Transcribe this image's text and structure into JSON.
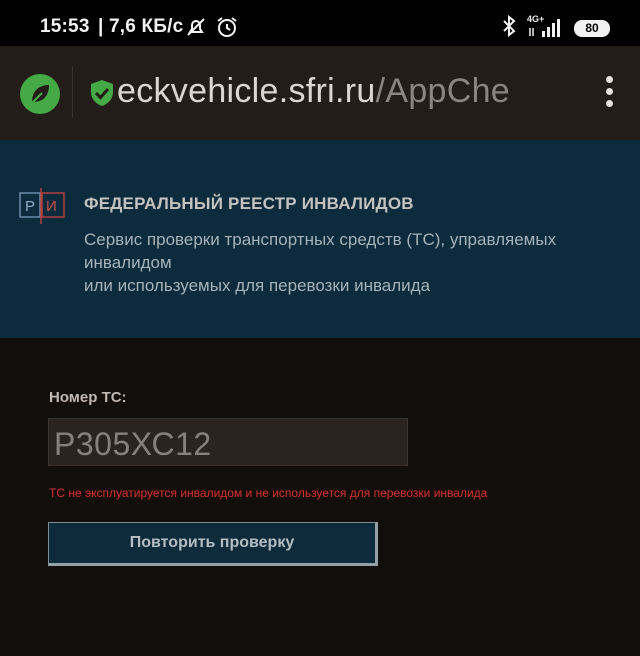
{
  "status_bar": {
    "time": "15:53",
    "speed": "| 7,6 КБ/с",
    "network": "4G+",
    "battery": "80",
    "icons": [
      "alarm-off-icon",
      "alarm-clock-icon",
      "bluetooth-icon",
      "signal-icon",
      "battery-icon"
    ]
  },
  "browser": {
    "url_host": "eckvehicle.sfri.ru",
    "url_path": "/AppChe",
    "icons": [
      "leaf-icon",
      "shield-check-icon",
      "more-vert-icon"
    ],
    "accent": "#45a946"
  },
  "banner": {
    "logo_letters": [
      "Р",
      "И"
    ],
    "title": "ФЕДЕРАЛЬНЫЙ РЕЕСТР ИНВАЛИДОВ",
    "subtitle_lines": [
      "Сервис проверки транспортных средств (ТС), управляемых",
      "инвалидом",
      "или используемых для перевозки инвалида"
    ],
    "background": "#0c2b3c"
  },
  "form": {
    "label": "Номер ТС:",
    "plate_value": "Р305ХС12",
    "error": "ТС не эксплуатируется инвалидом и не используется для перевозки инвалида",
    "error_color": "#d9302f",
    "button_label": "Повторить проверку"
  }
}
